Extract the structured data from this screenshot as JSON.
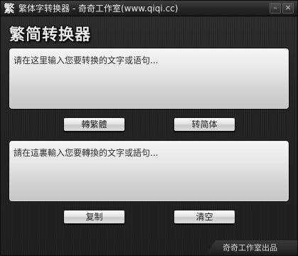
{
  "window": {
    "title": "繁体字转换器 - 奇奇工作室(www.qiqi.cc)",
    "app_icon_glyph": "繁",
    "minimize_glyph": "–",
    "close_glyph": "×"
  },
  "header": {
    "title": "繁简转换器"
  },
  "input_panel": {
    "placeholder": "请在这里输入您要转换的文字或语句..."
  },
  "buttons": {
    "to_traditional": "轉繁體",
    "to_simplified": "转简体",
    "copy": "复制",
    "clear": "清空"
  },
  "output_panel": {
    "placeholder": "請在這裏輸入您要轉換的文字或語句..."
  },
  "footer": {
    "credit": "奇奇工作室出品"
  }
}
